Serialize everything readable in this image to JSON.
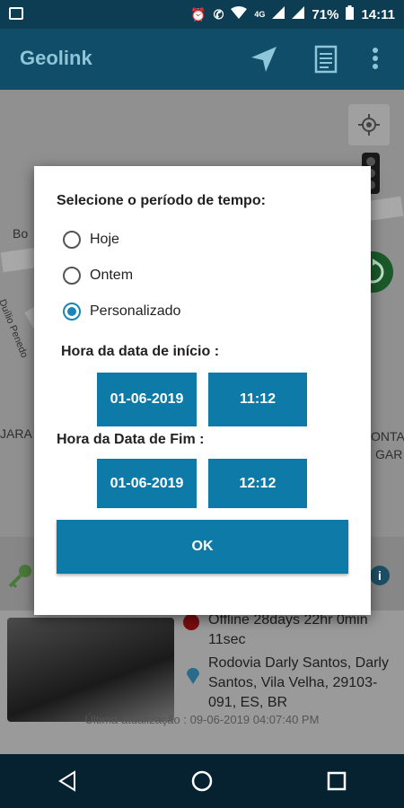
{
  "status_bar": {
    "battery": "71%",
    "time": "14:11",
    "network": "4G"
  },
  "app_bar": {
    "title": "Geolink"
  },
  "map": {
    "labels": [
      "Bo",
      "JARA",
      "ONTA",
      "GAR",
      "Duílio Penedo"
    ]
  },
  "panel": {
    "status_text": "Offline 28days 22hr 0min 11sec",
    "address": "Rodovia Darly Santos, Darly Santos, Vila Velha, 29103-091, ES, BR",
    "last_update": "Última atualização : 09-06-2019 04:07:40 PM"
  },
  "dialog": {
    "title": "Selecione o período de tempo:",
    "options": [
      "Hoje",
      "Ontem",
      "Personalizado"
    ],
    "selected_option": "Personalizado",
    "start_label": "Hora da data de início :",
    "start_date": "01-06-2019",
    "start_time": "11:12",
    "end_label": "Hora da Data de Fim :",
    "end_date": "01-06-2019",
    "end_time": "12:12",
    "ok_label": "OK"
  },
  "colors": {
    "accent": "#0e7aa8",
    "app_bar": "#0f4d68",
    "status_bar": "#0d3d52",
    "nav_bar": "#062230"
  },
  "icons": [
    "gallery-icon",
    "alarm-icon",
    "wifi-call-icon",
    "wifi-icon",
    "signal-icon",
    "battery-icon",
    "navigation-arrow-icon",
    "report-icon",
    "more-vert-icon",
    "location-target-icon",
    "traffic-light-icon",
    "refresh-icon",
    "key-icon",
    "info-icon",
    "pin-icon",
    "back-icon",
    "home-icon",
    "recents-icon"
  ]
}
